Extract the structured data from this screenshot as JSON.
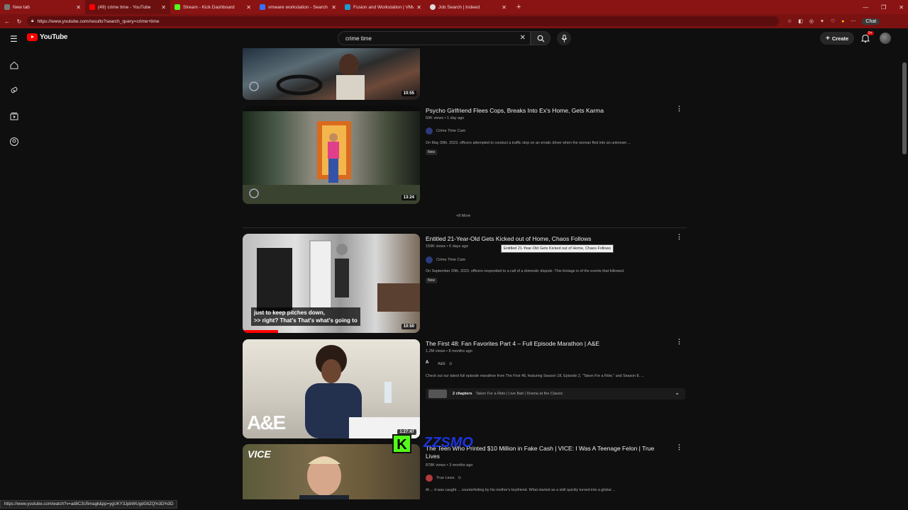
{
  "browser": {
    "tabs": [
      {
        "title": "New tab",
        "color": "#777777"
      },
      {
        "title": "(49) crime time - YouTube",
        "color": "#ff0000"
      },
      {
        "title": "Stream - Kick Dashboard",
        "color": "#53fc18"
      },
      {
        "title": "vmware workstation - Search",
        "color": "#3b6fff"
      },
      {
        "title": "Fusion and Workstation | VMware",
        "color": "#1d9bd1"
      },
      {
        "title": "Job Search | Indeed",
        "color": "#2557a7"
      }
    ],
    "url": "https://www.youtube.com/results?search_query=crime+time",
    "chat_label": "Chat"
  },
  "header": {
    "logo_text": "YouTube",
    "search_value": "crime time",
    "create_label": "Create",
    "notif_count": "9+"
  },
  "videos": [
    {
      "title": "",
      "duration": "10:55"
    },
    {
      "title": "Psycho Girlfriend Flees Cops, Breaks Into Ex's Home, Gets Karma",
      "meta": "69K views • 1 day ago",
      "channel": "Crime Time Cam",
      "desc": "On May 30th, 2023, officers attempted to conduct a traffic stop on an erratic driver when the woman fled into an unknown ...",
      "badge": "New",
      "duration": "13:24"
    },
    {
      "title": "Entitled 21-Year-Old Gets Kicked out of Home, Chaos Follows",
      "meta": "159K views • 6 days ago",
      "channel": "Crime Time Cam",
      "desc": "On September 20th, 2023, officers responded to a call of a domestic dispute. This footage is of the events that followed.",
      "badge": "New",
      "duration": "10:50",
      "caption_1": "just to keep pitches down,",
      "caption_2": ">> right? That's That's what's going to",
      "tooltip": "Entitled 21-Year-Old Gets Kicked out of Home, Chaos Follows"
    },
    {
      "title": "The First 48: Fan Favorites Part 4 – Full Episode Marathon | A&E",
      "meta": "1.2M views • 8 months ago",
      "channel": "A&E",
      "desc": "Check out our latest full episode marathon from The First 48, featuring Season 18, Episode 2, \"Taken For a Ride,\" and Season 8, ...",
      "chapters_count": "2 chapters",
      "chapters_text": "Taken For a Ride | Live Bait | Drama at the Classic",
      "duration": "1:27:47",
      "thumb_logo": "A&E"
    },
    {
      "title": "The Teen Who Printed $10 Million in Fake Cash | VICE: I Was A Teenage Felon | True Lives",
      "meta": "878K views • 3 months ago",
      "channel": "True Lives",
      "desc": "At ... it was caught ... counterfeiting by his mother's boyfriend. What started as a skill quickly turned into a global ...",
      "thumb_logo": "VICE"
    }
  ],
  "more_label": "+8 More",
  "status_url": "https://www.youtube.com/watch?v=ad8C3U5magk&pp=ygUKY3JpbWUgdGltZQ%3D%3D",
  "overlay": {
    "kick_letter": "K",
    "watermark": "ZZSMO"
  }
}
